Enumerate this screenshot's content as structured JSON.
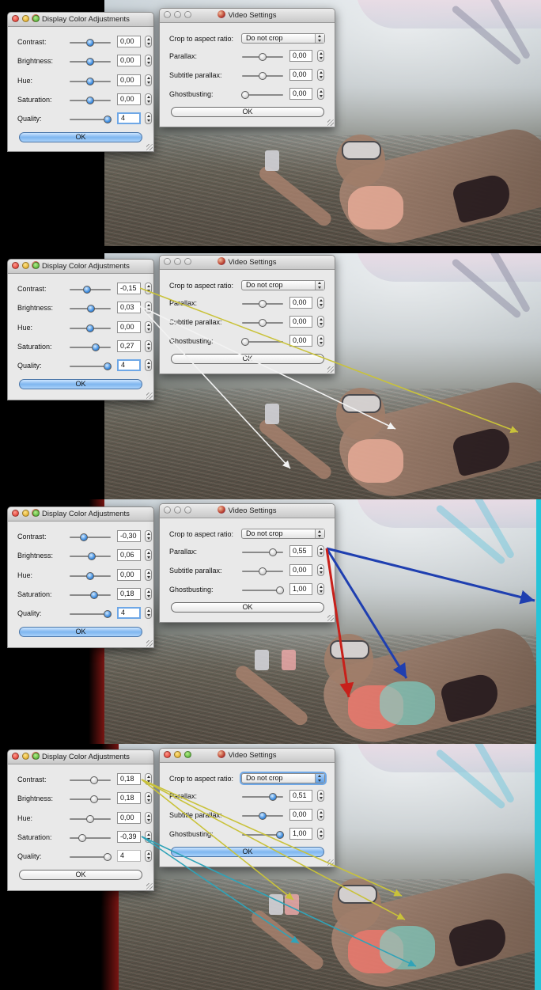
{
  "panels": [
    {
      "color_window": {
        "title": "Display Color Adjustments",
        "rows": [
          {
            "label": "Contrast:",
            "value": "0,00"
          },
          {
            "label": "Brightness:",
            "value": "0,00"
          },
          {
            "label": "Hue:",
            "value": "0,00"
          },
          {
            "label": "Saturation:",
            "value": "0,00"
          },
          {
            "label": "Quality:",
            "value": "4"
          }
        ],
        "ok_label": "OK"
      },
      "video_window": {
        "title": "Video Settings",
        "crop_label": "Crop to aspect ratio:",
        "crop_value": "Do not crop",
        "rows": [
          {
            "label": "Parallax:",
            "value": "0,00"
          },
          {
            "label": "Subtitle parallax:",
            "value": "0,00"
          },
          {
            "label": "Ghostbusting:",
            "value": "0,00"
          }
        ],
        "ok_label": "OK"
      }
    },
    {
      "color_window": {
        "title": "Display Color Adjustments",
        "rows": [
          {
            "label": "Contrast:",
            "value": "-0,15"
          },
          {
            "label": "Brightness:",
            "value": "0,03"
          },
          {
            "label": "Hue:",
            "value": "0,00"
          },
          {
            "label": "Saturation:",
            "value": "0,27"
          },
          {
            "label": "Quality:",
            "value": "4"
          }
        ],
        "ok_label": "OK"
      },
      "video_window": {
        "title": "Video Settings",
        "crop_label": "Crop to aspect ratio:",
        "crop_value": "Do not crop",
        "rows": [
          {
            "label": "Parallax:",
            "value": "0,00"
          },
          {
            "label": "Subtitle parallax:",
            "value": "0,00"
          },
          {
            "label": "Ghostbusting:",
            "value": "0,00"
          }
        ],
        "ok_label": "OK"
      }
    },
    {
      "color_window": {
        "title": "Display Color Adjustments",
        "rows": [
          {
            "label": "Contrast:",
            "value": "-0,30"
          },
          {
            "label": "Brightness:",
            "value": "0,06"
          },
          {
            "label": "Hue:",
            "value": "0,00"
          },
          {
            "label": "Saturation:",
            "value": "0,18"
          },
          {
            "label": "Quality:",
            "value": "4"
          }
        ],
        "ok_label": "OK"
      },
      "video_window": {
        "title": "Video Settings",
        "crop_label": "Crop to aspect ratio:",
        "crop_value": "Do not crop",
        "rows": [
          {
            "label": "Parallax:",
            "value": "0,55"
          },
          {
            "label": "Subtitle parallax:",
            "value": "0,00"
          },
          {
            "label": "Ghostbusting:",
            "value": "1,00"
          }
        ],
        "ok_label": "OK"
      }
    },
    {
      "color_window": {
        "title": "Display Color Adjustments",
        "rows": [
          {
            "label": "Contrast:",
            "value": "0,18"
          },
          {
            "label": "Brightness:",
            "value": "0,18"
          },
          {
            "label": "Hue:",
            "value": "0,00"
          },
          {
            "label": "Saturation:",
            "value": "-0,39"
          },
          {
            "label": "Quality:",
            "value": "4"
          }
        ],
        "ok_label": "OK"
      },
      "video_window": {
        "title": "Video Settings",
        "crop_label": "Crop to aspect ratio:",
        "crop_value": "Do not crop",
        "rows": [
          {
            "label": "Parallax:",
            "value": "0,51"
          },
          {
            "label": "Subtitle parallax:",
            "value": "0,00"
          },
          {
            "label": "Ghostbusting:",
            "value": "1,00"
          }
        ],
        "ok_label": "OK"
      }
    }
  ],
  "colors": {
    "active_blue": "#3f8de0",
    "arrow_yellow": "#c9c23a",
    "arrow_white": "#f2f2f2",
    "arrow_blue": "#1f3fb0",
    "arrow_red": "#c8201a",
    "arrow_cyan": "#2fa3b8"
  }
}
